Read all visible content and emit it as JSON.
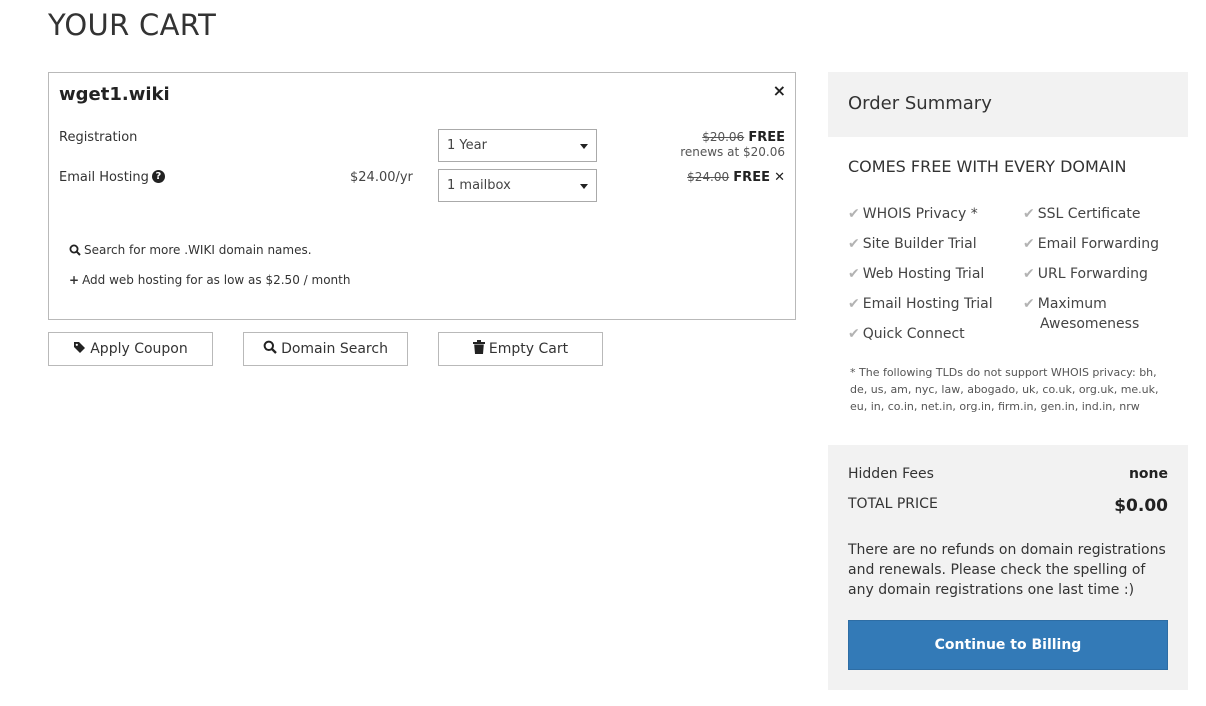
{
  "page": {
    "title": "YOUR CART"
  },
  "cart": {
    "domain": "wget1.wiki",
    "remove_icon": "×",
    "registration": {
      "label": "Registration",
      "term": "1 Year",
      "old_price": "$20.06",
      "price": "FREE",
      "renews": "renews at $20.06"
    },
    "email_hosting": {
      "label": "Email Hosting",
      "help_icon": "?",
      "unit_price": "$24.00/yr",
      "quantity": "1 mailbox",
      "old_price": "$24.00",
      "price": "FREE",
      "remove_icon": "✕"
    },
    "links": {
      "search_more": "Search for more .WIKI domain names.",
      "add_hosting": "Add web hosting for as low as $2.50 / month"
    }
  },
  "actions": {
    "apply_coupon": "Apply Coupon",
    "domain_search": "Domain Search",
    "empty_cart": "Empty Cart"
  },
  "summary": {
    "title": "Order Summary",
    "free_heading": "COMES FREE WITH EVERY DOMAIN",
    "features_left": [
      "WHOIS Privacy *",
      "Site Builder Trial",
      "Web Hosting Trial",
      "Email Hosting Trial",
      "Quick Connect"
    ],
    "features_right": [
      "SSL Certificate",
      "Email Forwarding",
      "URL Forwarding",
      "Maximum",
      "Awesomeness"
    ],
    "tld_note": "* The following TLDs do not support WHOIS privacy: bh, de, us, am, nyc, law, abogado, uk, co.uk, org.uk, me.uk, eu, in, co.in, net.in, org.in, firm.in, gen.in, ind.in, nrw"
  },
  "totals": {
    "hidden_fees_label": "Hidden Fees",
    "hidden_fees_value": "none",
    "total_label": "TOTAL PRICE",
    "total_value": "$0.00",
    "refund_note": "There are no refunds on domain registrations and renewals. Please check the spelling of any domain registrations one last time :)",
    "billing_button": "Continue to Billing"
  },
  "colors": {
    "primary": "#337ab7",
    "panel": "#f2f2f2",
    "check": "#b3b3b3"
  }
}
